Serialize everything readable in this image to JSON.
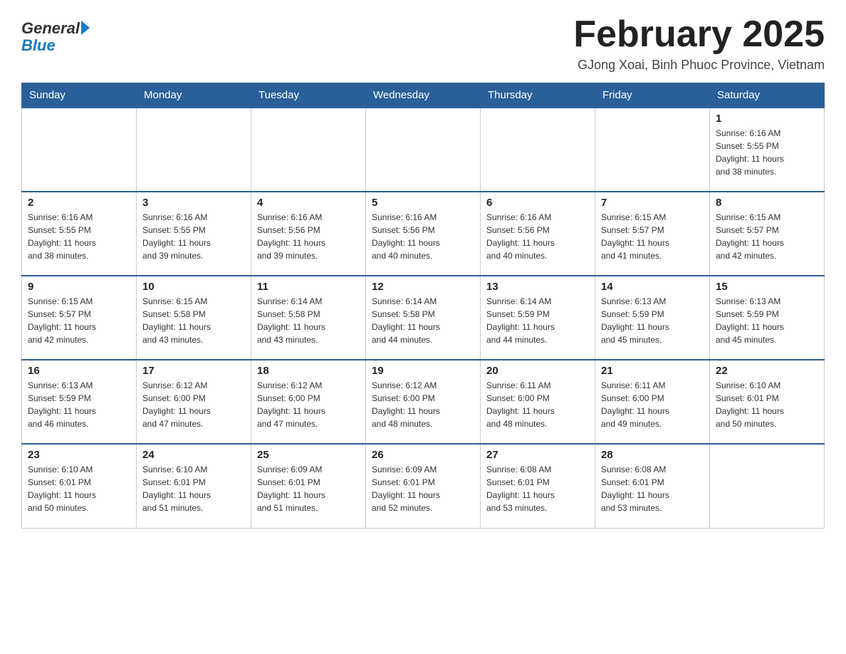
{
  "logo": {
    "general": "General",
    "blue": "Blue"
  },
  "header": {
    "month_year": "February 2025",
    "location": "GJong Xoai, Binh Phuoc Province, Vietnam"
  },
  "days_of_week": [
    "Sunday",
    "Monday",
    "Tuesday",
    "Wednesday",
    "Thursday",
    "Friday",
    "Saturday"
  ],
  "weeks": [
    [
      {
        "day": "",
        "detail": ""
      },
      {
        "day": "",
        "detail": ""
      },
      {
        "day": "",
        "detail": ""
      },
      {
        "day": "",
        "detail": ""
      },
      {
        "day": "",
        "detail": ""
      },
      {
        "day": "",
        "detail": ""
      },
      {
        "day": "1",
        "detail": "Sunrise: 6:16 AM\nSunset: 5:55 PM\nDaylight: 11 hours\nand 38 minutes."
      }
    ],
    [
      {
        "day": "2",
        "detail": "Sunrise: 6:16 AM\nSunset: 5:55 PM\nDaylight: 11 hours\nand 38 minutes."
      },
      {
        "day": "3",
        "detail": "Sunrise: 6:16 AM\nSunset: 5:55 PM\nDaylight: 11 hours\nand 39 minutes."
      },
      {
        "day": "4",
        "detail": "Sunrise: 6:16 AM\nSunset: 5:56 PM\nDaylight: 11 hours\nand 39 minutes."
      },
      {
        "day": "5",
        "detail": "Sunrise: 6:16 AM\nSunset: 5:56 PM\nDaylight: 11 hours\nand 40 minutes."
      },
      {
        "day": "6",
        "detail": "Sunrise: 6:16 AM\nSunset: 5:56 PM\nDaylight: 11 hours\nand 40 minutes."
      },
      {
        "day": "7",
        "detail": "Sunrise: 6:15 AM\nSunset: 5:57 PM\nDaylight: 11 hours\nand 41 minutes."
      },
      {
        "day": "8",
        "detail": "Sunrise: 6:15 AM\nSunset: 5:57 PM\nDaylight: 11 hours\nand 42 minutes."
      }
    ],
    [
      {
        "day": "9",
        "detail": "Sunrise: 6:15 AM\nSunset: 5:57 PM\nDaylight: 11 hours\nand 42 minutes."
      },
      {
        "day": "10",
        "detail": "Sunrise: 6:15 AM\nSunset: 5:58 PM\nDaylight: 11 hours\nand 43 minutes."
      },
      {
        "day": "11",
        "detail": "Sunrise: 6:14 AM\nSunset: 5:58 PM\nDaylight: 11 hours\nand 43 minutes."
      },
      {
        "day": "12",
        "detail": "Sunrise: 6:14 AM\nSunset: 5:58 PM\nDaylight: 11 hours\nand 44 minutes."
      },
      {
        "day": "13",
        "detail": "Sunrise: 6:14 AM\nSunset: 5:59 PM\nDaylight: 11 hours\nand 44 minutes."
      },
      {
        "day": "14",
        "detail": "Sunrise: 6:13 AM\nSunset: 5:59 PM\nDaylight: 11 hours\nand 45 minutes."
      },
      {
        "day": "15",
        "detail": "Sunrise: 6:13 AM\nSunset: 5:59 PM\nDaylight: 11 hours\nand 45 minutes."
      }
    ],
    [
      {
        "day": "16",
        "detail": "Sunrise: 6:13 AM\nSunset: 5:59 PM\nDaylight: 11 hours\nand 46 minutes."
      },
      {
        "day": "17",
        "detail": "Sunrise: 6:12 AM\nSunset: 6:00 PM\nDaylight: 11 hours\nand 47 minutes."
      },
      {
        "day": "18",
        "detail": "Sunrise: 6:12 AM\nSunset: 6:00 PM\nDaylight: 11 hours\nand 47 minutes."
      },
      {
        "day": "19",
        "detail": "Sunrise: 6:12 AM\nSunset: 6:00 PM\nDaylight: 11 hours\nand 48 minutes."
      },
      {
        "day": "20",
        "detail": "Sunrise: 6:11 AM\nSunset: 6:00 PM\nDaylight: 11 hours\nand 48 minutes."
      },
      {
        "day": "21",
        "detail": "Sunrise: 6:11 AM\nSunset: 6:00 PM\nDaylight: 11 hours\nand 49 minutes."
      },
      {
        "day": "22",
        "detail": "Sunrise: 6:10 AM\nSunset: 6:01 PM\nDaylight: 11 hours\nand 50 minutes."
      }
    ],
    [
      {
        "day": "23",
        "detail": "Sunrise: 6:10 AM\nSunset: 6:01 PM\nDaylight: 11 hours\nand 50 minutes."
      },
      {
        "day": "24",
        "detail": "Sunrise: 6:10 AM\nSunset: 6:01 PM\nDaylight: 11 hours\nand 51 minutes."
      },
      {
        "day": "25",
        "detail": "Sunrise: 6:09 AM\nSunset: 6:01 PM\nDaylight: 11 hours\nand 51 minutes."
      },
      {
        "day": "26",
        "detail": "Sunrise: 6:09 AM\nSunset: 6:01 PM\nDaylight: 11 hours\nand 52 minutes."
      },
      {
        "day": "27",
        "detail": "Sunrise: 6:08 AM\nSunset: 6:01 PM\nDaylight: 11 hours\nand 53 minutes."
      },
      {
        "day": "28",
        "detail": "Sunrise: 6:08 AM\nSunset: 6:01 PM\nDaylight: 11 hours\nand 53 minutes."
      },
      {
        "day": "",
        "detail": ""
      }
    ]
  ]
}
